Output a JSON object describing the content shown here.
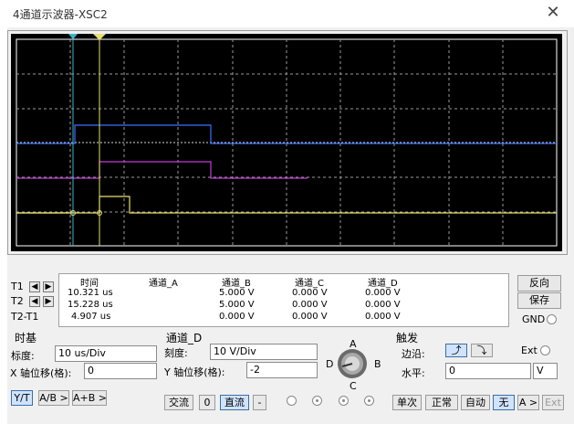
{
  "window": {
    "title": "4通道示波器-XSC2",
    "close_icon": "close-icon"
  },
  "cursors": {
    "t1_marker": "1",
    "t2_marker": "2"
  },
  "readout": {
    "headers": [
      "时间",
      "通道_A",
      "通道_B",
      "通道_C",
      "通道_D"
    ],
    "rows": [
      {
        "label": "T1",
        "time": "10.321 us",
        "a": "",
        "b": "5.000 V",
        "c": "0.000 V",
        "d": "0.000 V"
      },
      {
        "label": "T2",
        "time": "15.228 us",
        "a": "",
        "b": "5.000 V",
        "c": "0.000 V",
        "d": "0.000 V"
      },
      {
        "label": "T2-T1",
        "time": "4.907 us",
        "a": "",
        "b": "0.000 V",
        "c": "0.000 V",
        "d": "0.000 V"
      }
    ]
  },
  "side_buttons": {
    "reverse": "反向",
    "save": "保存",
    "gnd": "GND"
  },
  "timebase": {
    "title": "时基",
    "scale_label": "标度:",
    "scale_value": "10 us/Div",
    "x_pos_label": "X 轴位移(格):",
    "x_pos_value": "0",
    "mode_yt": "Y/T",
    "mode_ab": "A/B >",
    "mode_apb": "A+B >"
  },
  "channel": {
    "title": "通道_D",
    "scale_label": "刻度:",
    "scale_value": "10  V/Div",
    "y_pos_label": "Y 轴位移(格):",
    "y_pos_value": "-2",
    "ac": "交流",
    "zero": "0",
    "dc": "直流",
    "minus": "-",
    "knob_a": "A",
    "knob_b": "B",
    "knob_c": "C",
    "knob_d": "D"
  },
  "trigger": {
    "title": "触发",
    "edge_label": "边沿:",
    "ext_label": "Ext",
    "level_label": "水平:",
    "level_value": "0",
    "level_unit": "V",
    "single": "单次",
    "normal": "正常",
    "auto": "自动",
    "none": "无",
    "a_btn": "A >",
    "ext_btn": "Ext"
  }
}
